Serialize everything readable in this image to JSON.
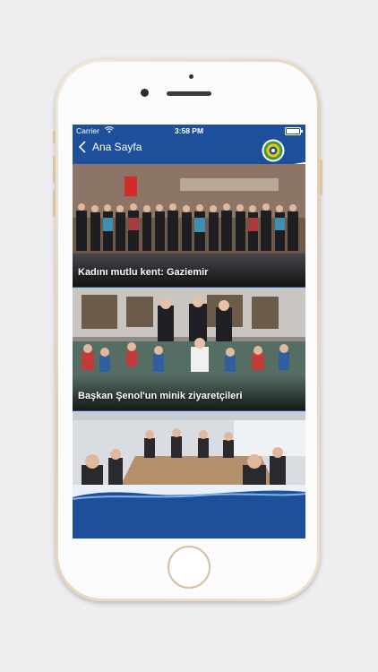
{
  "status_bar": {
    "carrier": "Carrier",
    "time": "3:58 PM"
  },
  "nav": {
    "back_label": "Ana Sayfa",
    "logo_icon": "municipality-seal-logo"
  },
  "feed": {
    "items": [
      {
        "title": "Kadını mutlu kent: Gaziemir"
      },
      {
        "title": "Başkan Şenol'un minik ziyaretçileri"
      },
      {
        "title": ""
      }
    ]
  },
  "colors": {
    "nav_blue": "#1d4f9a",
    "wave_light": "#e8f1fb",
    "gold_frame": "#e2cfb1"
  }
}
